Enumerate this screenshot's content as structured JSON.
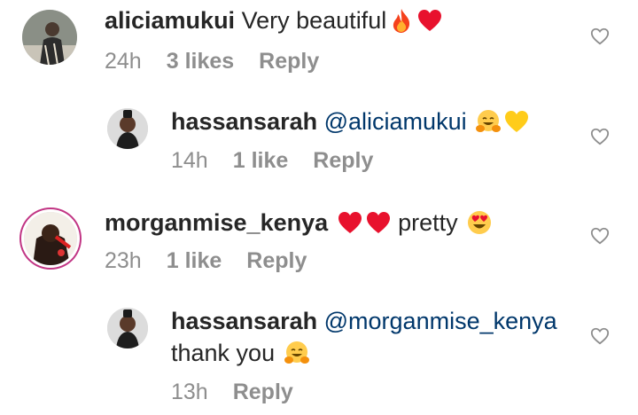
{
  "comments": [
    {
      "username": "aliciamukui",
      "text": "Very beautiful",
      "emojis": [
        "fire-emoji",
        "red-heart-emoji"
      ],
      "time": "24h",
      "likes": "3 likes",
      "reply": "Reply"
    },
    {
      "username": "hassansarah",
      "mention": "@aliciamukui",
      "emojis": [
        "hugging-face-emoji",
        "yellow-heart-emoji"
      ],
      "time": "14h",
      "likes": "1 like",
      "reply": "Reply"
    },
    {
      "username": "morganmise_kenya",
      "text": "pretty",
      "emojis_before": [
        "red-heart-emoji",
        "red-heart-emoji"
      ],
      "emojis_after": [
        "heart-eyes-emoji"
      ],
      "time": "23h",
      "likes": "1 like",
      "reply": "Reply"
    },
    {
      "username": "hassansarah",
      "mention": "@morganmise_kenya",
      "text": "thank you",
      "emojis": [
        "hugging-face-emoji"
      ],
      "time": "13h",
      "reply": "Reply"
    }
  ],
  "colors": {
    "username": "#262626",
    "mention": "#00376b",
    "meta": "#8e8e8e",
    "heart_outline": "#8e8e8e"
  }
}
